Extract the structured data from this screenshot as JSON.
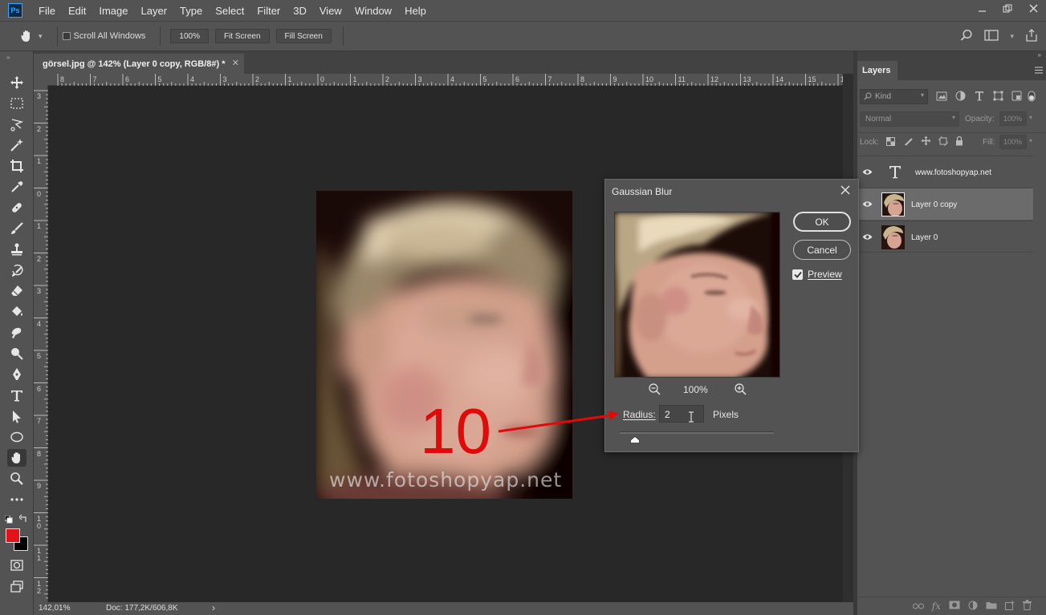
{
  "app": {
    "logo_text": "Ps"
  },
  "menu": [
    "File",
    "Edit",
    "Image",
    "Layer",
    "Type",
    "Select",
    "Filter",
    "3D",
    "View",
    "Window",
    "Help"
  ],
  "options_bar": {
    "scroll_all_windows": "Scroll All Windows",
    "zoom_100": "100%",
    "fit_screen": "Fit Screen",
    "fill_screen": "Fill Screen"
  },
  "document": {
    "tab_title": "görsel.jpg @ 142% (Layer 0 copy, RGB/8#) *",
    "watermark": "www.fotoshopyap.net"
  },
  "ruler_h": [
    "8",
    "7",
    "6",
    "5",
    "4",
    "3",
    "2",
    "1",
    "0",
    "1",
    "2",
    "3",
    "4",
    "5",
    "6",
    "7",
    "8",
    "9",
    "10",
    "11",
    "12",
    "13",
    "14",
    "15",
    "1"
  ],
  "ruler_v": [
    "3",
    "2",
    "1",
    "0",
    "1",
    "2",
    "3",
    "4",
    "5",
    "6",
    "7",
    "8",
    "9",
    "1\n0",
    "1\n1",
    "1\n2"
  ],
  "status_bar": {
    "zoom": "142,01%",
    "doc": "Doc: 177,2K/606,8K",
    "arrow": "›"
  },
  "layers_panel": {
    "title": "Layers",
    "kind": "Kind",
    "blend_mode": "Normal",
    "opacity_label": "Opacity:",
    "opacity_value": "100%",
    "lock_label": "Lock:",
    "fill_label": "Fill:",
    "fill_value": "100%",
    "layers": [
      {
        "name": "www.fotoshopyap.net",
        "type": "text",
        "selected": false
      },
      {
        "name": "Layer 0 copy",
        "type": "image",
        "selected": true
      },
      {
        "name": "Layer 0",
        "type": "image",
        "selected": false
      }
    ]
  },
  "dialog": {
    "title": "Gaussian Blur",
    "ok": "OK",
    "cancel": "Cancel",
    "preview_label": "Preview",
    "preview_checked": true,
    "zoom": "100%",
    "radius_label": "Radius:",
    "radius_value": "2",
    "radius_unit": "Pixels"
  },
  "annotation": {
    "number": "10",
    "color": "#e10a0a"
  },
  "colors": {
    "foreground": "#e1131b",
    "background": "#000000",
    "accent": "#31a8ff"
  }
}
